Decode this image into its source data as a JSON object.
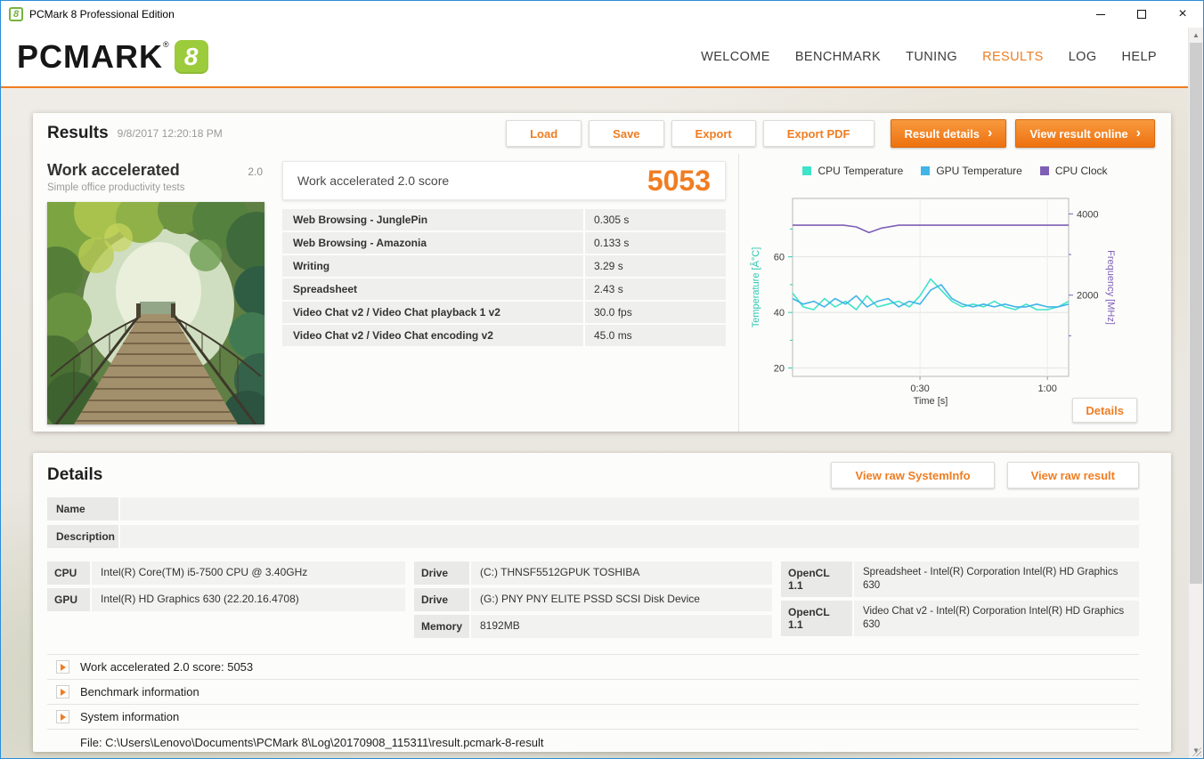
{
  "window": {
    "title": "PCMark 8 Professional Edition",
    "brand": "PCMARK",
    "brand_number": "8"
  },
  "icons": {
    "registered": "®",
    "chevron_right": "›",
    "scroll_up": "▲",
    "scroll_down": "▼",
    "window_close": "×"
  },
  "nav": {
    "items": [
      "WELCOME",
      "BENCHMARK",
      "TUNING",
      "RESULTS",
      "LOG",
      "HELP"
    ]
  },
  "results": {
    "title": "Results",
    "timestamp": "9/8/2017 12:20:18 PM",
    "buttons": {
      "load": "Load",
      "save": "Save",
      "export": "Export",
      "export_pdf": "Export PDF",
      "result_details": "Result details",
      "view_online": "View result online",
      "chart_details": "Details"
    },
    "test": {
      "name": "Work accelerated",
      "version": "2.0",
      "subtitle": "Simple office productivity tests"
    },
    "score": {
      "label": "Work accelerated 2.0 score",
      "value": "5053"
    },
    "metrics": [
      {
        "label": "Web Browsing - JunglePin",
        "value": "0.305 s"
      },
      {
        "label": "Web Browsing - Amazonia",
        "value": "0.133 s"
      },
      {
        "label": "Writing",
        "value": "3.29 s"
      },
      {
        "label": "Spreadsheet",
        "value": "2.43 s"
      },
      {
        "label": "Video Chat v2 / Video Chat playback 1 v2",
        "value": "30.0 fps"
      },
      {
        "label": "Video Chat v2 / Video Chat encoding v2",
        "value": "45.0 ms"
      }
    ]
  },
  "chart_data": {
    "type": "line",
    "legend": [
      {
        "name": "CPU Temperature",
        "color": "#3fe3c9"
      },
      {
        "name": "GPU Temperature",
        "color": "#41b4e8"
      },
      {
        "name": "CPU Clock",
        "color": "#7e5fb5"
      }
    ],
    "left_axis": {
      "label": "Temperature [Â°C]",
      "color": "#2cc8b0",
      "ticks": [
        20,
        40,
        60
      ],
      "minor": [
        30,
        50,
        70
      ],
      "range": [
        17,
        81
      ]
    },
    "right_axis": {
      "label": "Frequency [MHz]",
      "color": "#7e5fb5",
      "ticks": [
        2000,
        4000
      ],
      "minor": [
        1000,
        3000
      ],
      "range": [
        0,
        4380
      ]
    },
    "x_axis": {
      "label": "Time [s]",
      "range": [
        0,
        65
      ],
      "ticks": [
        {
          "s": 30,
          "label": "0:30"
        },
        {
          "s": 60,
          "label": "1:00"
        }
      ]
    },
    "series": [
      {
        "name": "CPU Temperature",
        "axis": "left",
        "color": "#3fe3c9",
        "points": [
          [
            0,
            47
          ],
          [
            2.5,
            42
          ],
          [
            5,
            41
          ],
          [
            7.5,
            45
          ],
          [
            10,
            42
          ],
          [
            12.5,
            44
          ],
          [
            15,
            41
          ],
          [
            17.5,
            46
          ],
          [
            20,
            42
          ],
          [
            22.5,
            43
          ],
          [
            25,
            44
          ],
          [
            27.5,
            42
          ],
          [
            30,
            46
          ],
          [
            32.5,
            52
          ],
          [
            35,
            48
          ],
          [
            37.5,
            44
          ],
          [
            40,
            42
          ],
          [
            42.5,
            43
          ],
          [
            45,
            42
          ],
          [
            47.5,
            44
          ],
          [
            50,
            42
          ],
          [
            52.5,
            41
          ],
          [
            55,
            43
          ],
          [
            57.5,
            41
          ],
          [
            60,
            41
          ],
          [
            62.5,
            42
          ],
          [
            65,
            44
          ]
        ]
      },
      {
        "name": "GPU Temperature",
        "axis": "left",
        "color": "#41b4e8",
        "points": [
          [
            0,
            45
          ],
          [
            2.5,
            43
          ],
          [
            5,
            44
          ],
          [
            7.5,
            42
          ],
          [
            10,
            45
          ],
          [
            12.5,
            43
          ],
          [
            15,
            46
          ],
          [
            17.5,
            42
          ],
          [
            20,
            44
          ],
          [
            22.5,
            45
          ],
          [
            25,
            42
          ],
          [
            27.5,
            44
          ],
          [
            30,
            43
          ],
          [
            32.5,
            48
          ],
          [
            35,
            50
          ],
          [
            37.5,
            45
          ],
          [
            40,
            43
          ],
          [
            42.5,
            42
          ],
          [
            45,
            43
          ],
          [
            47.5,
            42
          ],
          [
            50,
            43
          ],
          [
            52.5,
            42
          ],
          [
            55,
            42
          ],
          [
            57.5,
            43
          ],
          [
            60,
            42
          ],
          [
            62.5,
            42
          ],
          [
            65,
            43
          ]
        ]
      },
      {
        "name": "CPU Clock",
        "axis": "right",
        "color": "#7e5fb5",
        "points": [
          [
            0,
            3720
          ],
          [
            12,
            3720
          ],
          [
            15,
            3680
          ],
          [
            18,
            3540
          ],
          [
            21,
            3650
          ],
          [
            25,
            3720
          ],
          [
            65,
            3720
          ]
        ]
      }
    ]
  },
  "details": {
    "title": "Details",
    "buttons": {
      "raw_systeminfo": "View raw SystemInfo",
      "raw_result": "View raw result"
    },
    "fields": [
      {
        "label": "Name",
        "value": ""
      },
      {
        "label": "Description",
        "value": ""
      }
    ],
    "system": {
      "col1": [
        {
          "label": "CPU",
          "value": "Intel(R) Core(TM) i5-7500 CPU @ 3.40GHz"
        },
        {
          "label": "GPU",
          "value": "Intel(R) HD Graphics 630 (22.20.16.4708)"
        }
      ],
      "col2": [
        {
          "label": "Drive",
          "value": "(C:) THNSF5512GPUK TOSHIBA"
        },
        {
          "label": "Drive",
          "value": "(G:) PNY PNY ELITE PSSD SCSI Disk Device"
        },
        {
          "label": "Memory",
          "value": "8192MB"
        }
      ],
      "col3": [
        {
          "label": "OpenCL 1.1",
          "value": "Spreadsheet - Intel(R) Corporation Intel(R) HD Graphics 630"
        },
        {
          "label": "OpenCL 1.1",
          "value": "Video Chat v2 - Intel(R) Corporation Intel(R) HD Graphics 630"
        }
      ]
    },
    "expanders": [
      "Work accelerated 2.0 score: 5053",
      "Benchmark information",
      "System information"
    ],
    "file_line": "File: C:\\Users\\Lenovo\\Documents\\PCMark 8\\Log\\20170908_115311\\result.pcmark-8-result"
  }
}
